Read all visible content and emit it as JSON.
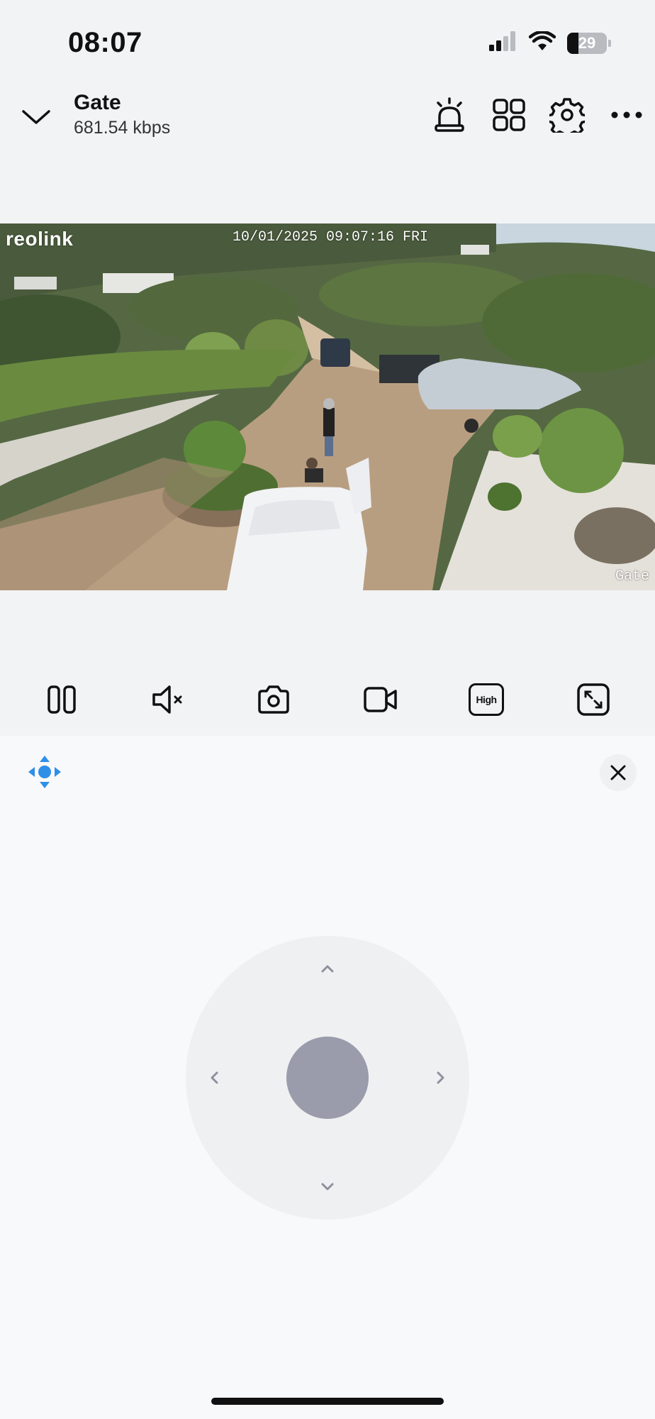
{
  "status_bar": {
    "time": "08:07",
    "battery_percent": "29",
    "icons": [
      "cellular-signal-icon",
      "wifi-icon",
      "battery-icon"
    ]
  },
  "header": {
    "camera_name": "Gate",
    "bitrate": "681.54 kbps",
    "icons": [
      "chevron-down-icon",
      "siren-icon",
      "grid-view-icon",
      "gear-icon",
      "more-icon"
    ]
  },
  "video": {
    "brand_watermark": "reolink",
    "timestamp": "10/01/2025 09:07:16 FRI",
    "channel_name": "Gate"
  },
  "controls": {
    "quality_label": "High",
    "icons": [
      "pause-icon",
      "speaker-muted-icon",
      "camera-snapshot-icon",
      "video-record-icon",
      "quality-icon",
      "fullscreen-icon"
    ]
  },
  "ptz": {
    "icons": [
      "ptz-move-icon",
      "close-icon",
      "arrow-up-icon",
      "arrow-down-icon",
      "arrow-left-icon",
      "arrow-right-icon"
    ]
  },
  "colors": {
    "accent": "#2f8fe6",
    "joystick_knob": "#9a9cab",
    "joystick_pad": "#eff0f2",
    "panel_bg": "#f8f9fa",
    "page_bg": "#f2f3f5"
  }
}
